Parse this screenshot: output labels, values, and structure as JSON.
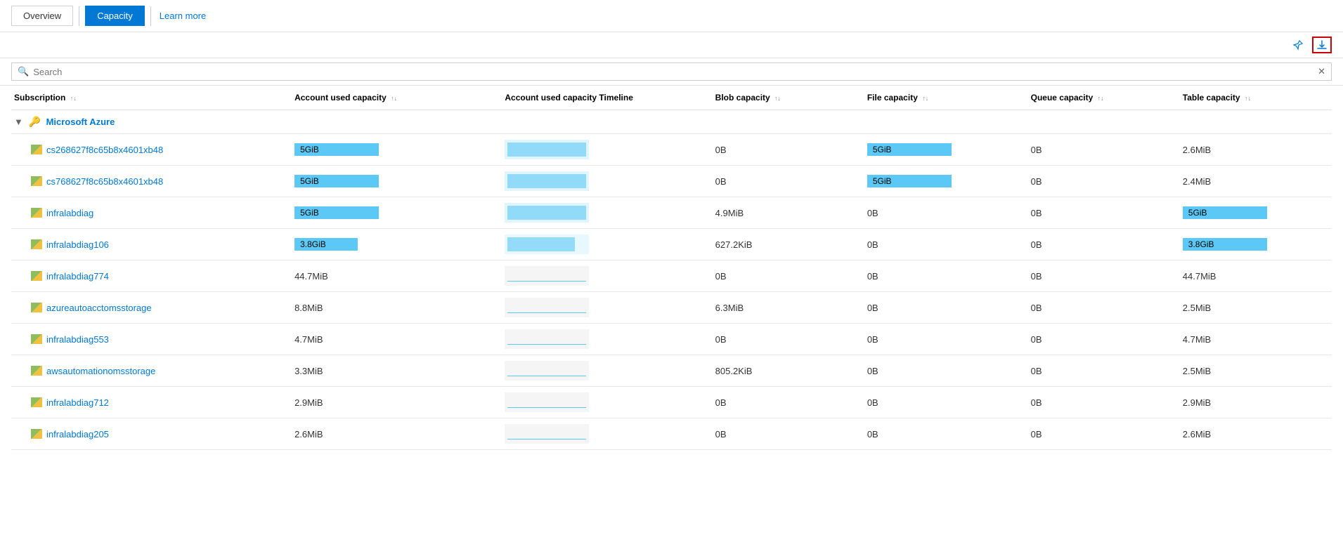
{
  "tabs": {
    "overview": {
      "label": "Overview",
      "active": false
    },
    "capacity": {
      "label": "Capacity",
      "active": true
    },
    "learn_more": {
      "label": "Learn more"
    }
  },
  "toolbar": {
    "pin_icon": "📌",
    "download_icon": "⬇"
  },
  "search": {
    "placeholder": "Search",
    "clear_icon": "✕"
  },
  "columns": [
    {
      "label": "Subscription",
      "sort": true
    },
    {
      "label": "Account used capacity",
      "sort": true
    },
    {
      "label": "Account used capacity Timeline",
      "sort": false
    },
    {
      "label": "Blob capacity",
      "sort": true
    },
    {
      "label": "File capacity",
      "sort": true
    },
    {
      "label": "Queue capacity",
      "sort": true
    },
    {
      "label": "Table capacity",
      "sort": true
    }
  ],
  "group": {
    "name": "Microsoft Azure",
    "type": "subscription_group"
  },
  "rows": [
    {
      "name": "cs268627f8c65b8x4601xb48",
      "account_used": "5GiB",
      "account_used_bar": true,
      "account_used_bar_type": "filled",
      "timeline_type": "filled",
      "blob": "0B",
      "file": "5GiB",
      "file_bar": true,
      "queue": "0B",
      "table": "2.6MiB",
      "table_bar": false
    },
    {
      "name": "cs768627f8c65b8x4601xb48",
      "account_used": "5GiB",
      "account_used_bar": true,
      "account_used_bar_type": "filled",
      "timeline_type": "filled",
      "blob": "0B",
      "file": "5GiB",
      "file_bar": true,
      "queue": "0B",
      "table": "2.4MiB",
      "table_bar": false
    },
    {
      "name": "infralabdiag",
      "account_used": "5GiB",
      "account_used_bar": true,
      "account_used_bar_type": "filled",
      "timeline_type": "filled",
      "blob": "4.9MiB",
      "file": "0B",
      "file_bar": false,
      "queue": "0B",
      "table": "5GiB",
      "table_bar": true
    },
    {
      "name": "infralabdiag106",
      "account_used": "3.8GiB",
      "account_used_bar": true,
      "account_used_bar_type": "partial",
      "timeline_type": "partial",
      "blob": "627.2KiB",
      "file": "0B",
      "file_bar": false,
      "queue": "0B",
      "table": "3.8GiB",
      "table_bar": true
    },
    {
      "name": "infralabdiag774",
      "account_used": "44.7MiB",
      "account_used_bar": false,
      "timeline_type": "line",
      "blob": "0B",
      "file": "0B",
      "file_bar": false,
      "queue": "0B",
      "table": "44.7MiB",
      "table_bar": false
    },
    {
      "name": "azureautoacctomsstorage",
      "account_used": "8.8MiB",
      "account_used_bar": false,
      "timeline_type": "line",
      "blob": "6.3MiB",
      "file": "0B",
      "file_bar": false,
      "queue": "0B",
      "table": "2.5MiB",
      "table_bar": false
    },
    {
      "name": "infralabdiag553",
      "account_used": "4.7MiB",
      "account_used_bar": false,
      "timeline_type": "line",
      "blob": "0B",
      "file": "0B",
      "file_bar": false,
      "queue": "0B",
      "table": "4.7MiB",
      "table_bar": false
    },
    {
      "name": "awsautomationomsstorage",
      "account_used": "3.3MiB",
      "account_used_bar": false,
      "timeline_type": "line",
      "blob": "805.2KiB",
      "file": "0B",
      "file_bar": false,
      "queue": "0B",
      "table": "2.5MiB",
      "table_bar": false
    },
    {
      "name": "infralabdiag712",
      "account_used": "2.9MiB",
      "account_used_bar": false,
      "timeline_type": "line",
      "blob": "0B",
      "file": "0B",
      "file_bar": false,
      "queue": "0B",
      "table": "2.9MiB",
      "table_bar": false
    },
    {
      "name": "infralabdiag205",
      "account_used": "2.6MiB",
      "account_used_bar": false,
      "timeline_type": "line",
      "blob": "0B",
      "file": "0B",
      "file_bar": false,
      "queue": "0B",
      "table": "2.6MiB",
      "table_bar": false
    }
  ]
}
